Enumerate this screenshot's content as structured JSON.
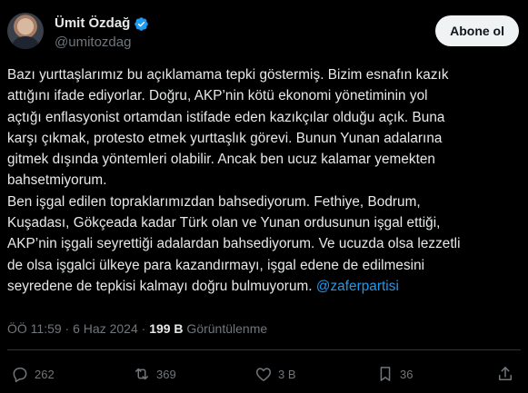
{
  "author": {
    "display_name": "Ümit Özdağ",
    "username": "@umitozdag",
    "verified_icon": "verified-badge-icon"
  },
  "follow_button_label": "Abone ol",
  "tweet": {
    "text_part1": "Bazı yurttaşlarımız bu açıklamama tepki göstermiş. Bizim esnafın kazık\nattığını ifade ediyorlar. Doğru, AKP’nin kötü ekonomi yönetiminin yol\naçtığı enflasyonist ortamdan istifade eden kazıkçılar olduğu açık. Buna\nkarşı çıkmak, protesto etmek yurttaşlık görevi. Bunun Yunan adalarına\ngitmek dışında yöntemleri olabilir. Ancak ben ucuz kalamar yemekten\nbahsetmiyorum.\nBen işgal edilen topraklarımızdan bahsediyorum. Fethiye, Bodrum,\nKuşadası, Gökçeada kadar Türk olan ve Yunan ordusunun işgal ettiği,\nAKP’nin işgali seyrettiği adalardan bahsediyorum. Ve ucuzda olsa lezzetli\nde olsa işgalci ülkeye para kazandırmayı, işgal edene de edilmesini\nseyredene de tepkisi kalmayı doğru bulmuyorum. ",
    "mention": "@zaferpartisi"
  },
  "meta": {
    "time": "ÖÖ 11:59",
    "separator1": " · ",
    "date": "6 Haz 2024",
    "separator2": " · ",
    "views_count": "199 B",
    "views_label": " Görüntülenme"
  },
  "actions": {
    "reply_count": "262",
    "retweet_count": "369",
    "like_count": "3 B",
    "bookmark_count": "36"
  },
  "colors": {
    "background": "#000000",
    "text": "#e7e9ea",
    "secondary": "#71767b",
    "accent": "#1d9bf0"
  }
}
